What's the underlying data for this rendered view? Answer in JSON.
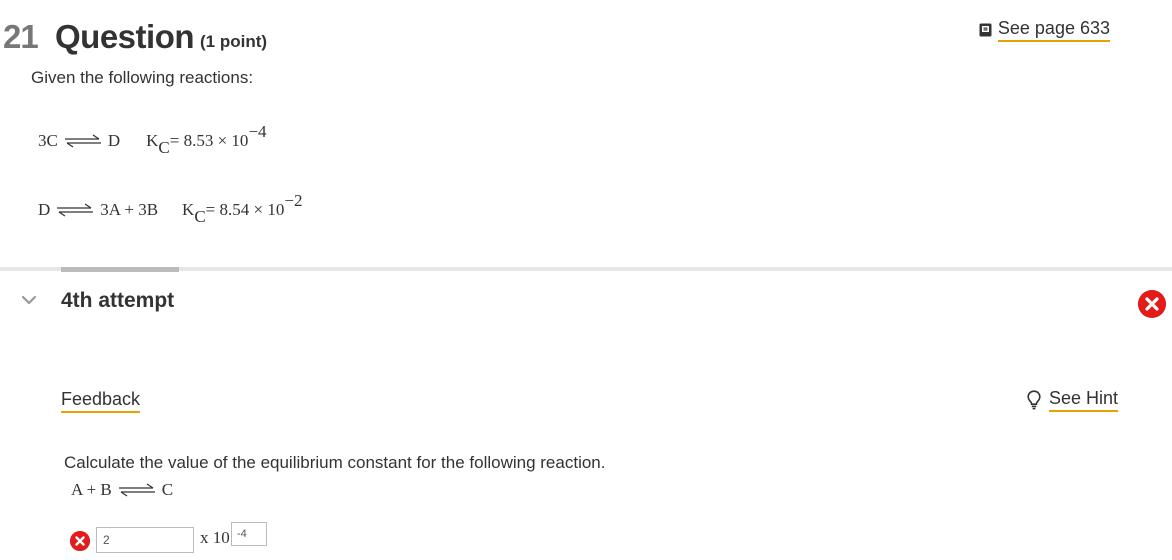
{
  "question": {
    "number": "21",
    "title": "Question",
    "points": "(1 point)",
    "see_page": "See page 633",
    "intro": "Given the following reactions:"
  },
  "reactions": [
    {
      "lhs": "3C",
      "rhs": "D",
      "k_symbol": "K",
      "k_sub": "C",
      "k_value": "= 8.53 × 10",
      "k_exp": "−4"
    },
    {
      "lhs": "D",
      "rhs": "3A + 3B",
      "k_symbol": "K",
      "k_sub": "C",
      "k_value": "= 8.54 × 10",
      "k_exp": "−2"
    }
  ],
  "attempt": {
    "label": "4th attempt",
    "status": "incorrect",
    "feedback_label": "Feedback",
    "hint_label": "See Hint",
    "prompt": "Calculate the value of the equilibrium constant for the following reaction.",
    "target_reaction": {
      "lhs": "A + B",
      "rhs": "C"
    },
    "answer_mantissa": "2",
    "times_label": "x 10",
    "answer_exponent": "-4"
  },
  "colors": {
    "error": "#e01c1c",
    "link_underline": "#e8a200",
    "divider": "#e6e6e6"
  },
  "icons": {
    "see_page": "book-icon",
    "hint": "lightbulb-icon",
    "collapse": "chevron-down-icon",
    "status": "x-circle-icon"
  }
}
